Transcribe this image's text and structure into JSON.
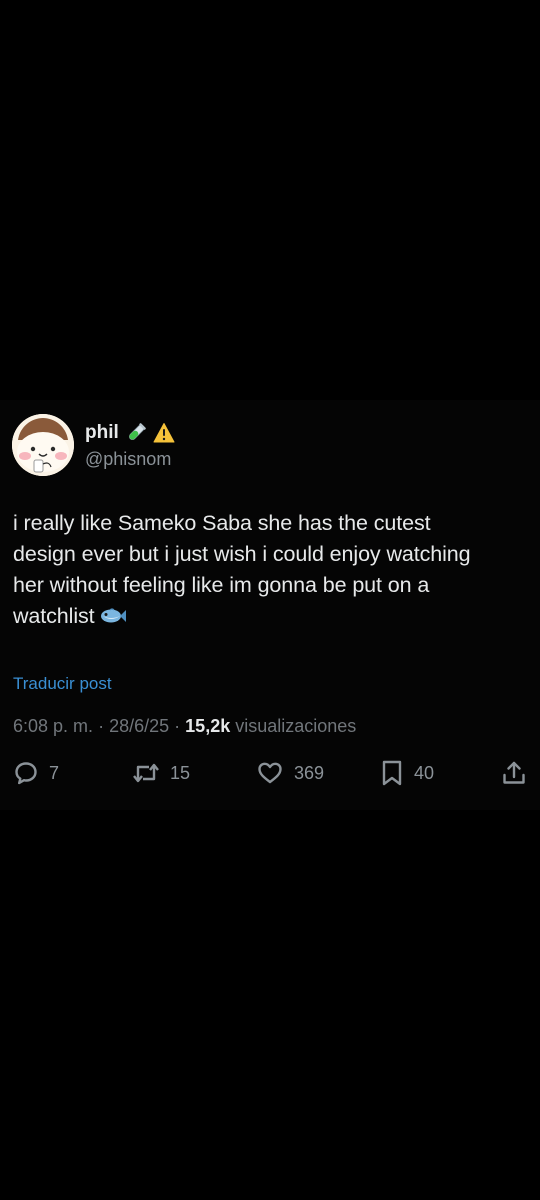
{
  "post": {
    "author": {
      "display_name": "phil",
      "handle": "@phisnom",
      "badges": [
        "test-tube-emoji",
        "warning-emoji"
      ]
    },
    "body_lines": [
      "i really like Sameko Saba she has the cutest",
      "design ever but i just wish i could enjoy watching",
      "her without feeling like im gonna be put on a",
      "watchlist"
    ],
    "body_emoji": "fish-emoji",
    "translate_label": "Traducir post",
    "meta": {
      "time": "6:08 p. m.",
      "date": "28/6/25",
      "separator": "·",
      "views_count": "15,2k",
      "views_label": "visualizaciones"
    },
    "actions": {
      "replies": "7",
      "reposts": "15",
      "likes": "369",
      "bookmarks": "40"
    }
  },
  "colors": {
    "background": "#000000",
    "text_primary": "#e7e9ea",
    "text_secondary": "#71767b",
    "link": "#3a8fd4"
  }
}
